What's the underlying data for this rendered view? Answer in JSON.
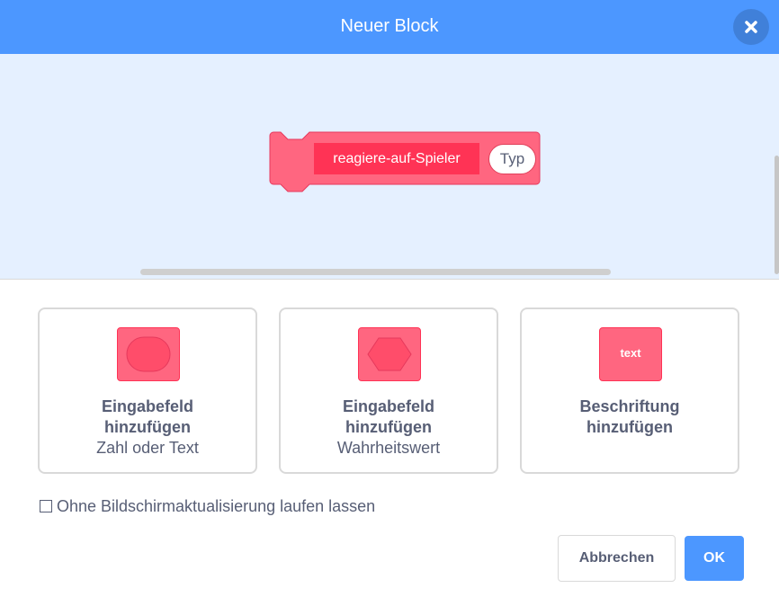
{
  "dialog": {
    "title": "Neuer Block",
    "close_icon": "close-icon"
  },
  "preview": {
    "block_label": "reagiere-auf-Spieler",
    "argument": "Typ",
    "block_color": "#ff6680",
    "label_highlight_color": "#ff3355"
  },
  "options": [
    {
      "icon": "round-input-icon",
      "title_line1": "Eingabefeld",
      "title_line2": "hinzufügen",
      "subtitle": "Zahl oder Text"
    },
    {
      "icon": "boolean-input-icon",
      "title_line1": "Eingabefeld",
      "title_line2": "hinzufügen",
      "subtitle": "Wahrheitswert"
    },
    {
      "icon": "label-icon",
      "icon_text": "text",
      "title_line1": "Beschriftung",
      "title_line2": "hinzufügen",
      "subtitle": ""
    }
  ],
  "run_without_refresh": {
    "label": "Ohne Bildschirmaktualisierung laufen lassen",
    "checked": false
  },
  "buttons": {
    "cancel": "Abbrechen",
    "ok": "OK"
  },
  "colors": {
    "header": "#4c97ff",
    "preview_bg": "#e5f0ff",
    "text": "#575e75"
  }
}
